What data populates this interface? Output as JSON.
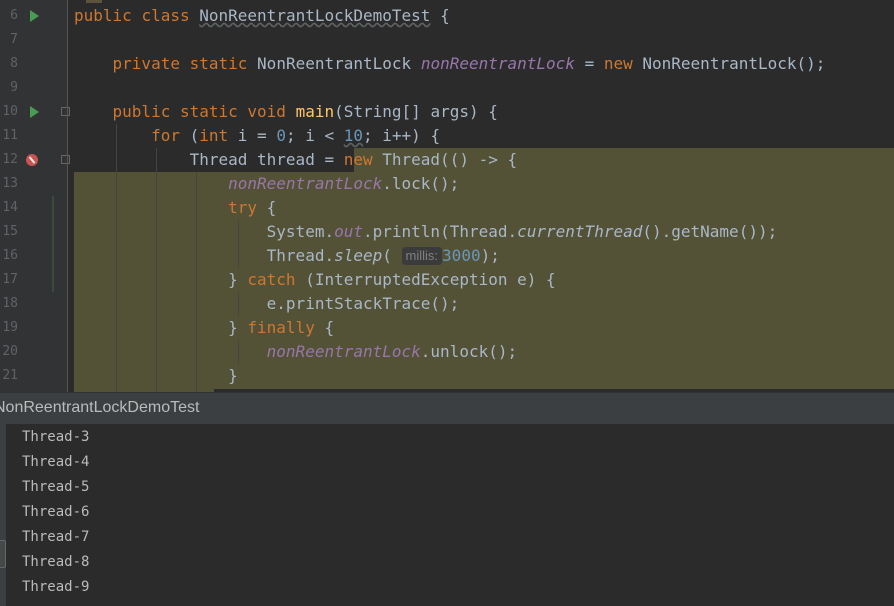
{
  "editor": {
    "line_numbers": [
      "6",
      "7",
      "8",
      "9",
      "10",
      "11",
      "12",
      "13",
      "14",
      "15",
      "16",
      "17",
      "18",
      "19",
      "20",
      "21"
    ],
    "hint_millis": "millis:",
    "tokens": {
      "kw_public": "public",
      "kw_class": "class",
      "class_name": "NonReentrantLockDemoTest",
      "brace_open": " {",
      "kw_private": "private",
      "kw_static": "static",
      "type_lock": "NonReentrantLock",
      "field_lock": "nonReentrantLock",
      "assign": " = ",
      "kw_new": "new",
      "ctor_lock": " NonReentrantLock();",
      "kw_void": "void",
      "method_main": "main",
      "main_params": "(String[] args) {",
      "kw_for": "for",
      "for_open": " (",
      "kw_int": "int",
      "for_init": " i = ",
      "num_0": "0",
      "for_cond": "; i < ",
      "num_10": "10",
      "for_end": "; i++) {",
      "thread_decl": "Thread thread = ",
      "thread_ctor": " Thread(() -> {",
      "lock_call": ".lock();",
      "kw_try": "try",
      "system": "System.",
      "out": "out",
      "println_open": ".println(Thread.",
      "current_thread": "currentThread",
      "println_close": "().getName());",
      "thread_dot": "Thread.",
      "sleep": "sleep",
      "paren_open": "(",
      "num_3000": "3000",
      "paren_close": ");",
      "catch_open": "} ",
      "kw_catch": "catch",
      "catch_params": " (InterruptedException e) {",
      "print_stack": "e.printStackTrace();",
      "kw_finally": "finally",
      "unlock_call": ".unlock();",
      "close_brace": "}"
    }
  },
  "run_panel": {
    "title": "NonReentrantLockDemoTest",
    "output": [
      "Thread-3",
      "Thread-4",
      "Thread-5",
      "Thread-6",
      "Thread-7",
      "Thread-8",
      "Thread-9"
    ]
  },
  "colors": {
    "background": "#2b2b2b",
    "keyword": "#cc7832",
    "method": "#ffc66d",
    "field": "#9876aa",
    "number": "#6897bb",
    "plain": "#a9b7c6",
    "highlight": "#535237",
    "run_icon": "#499c54",
    "breakpoint": "#c75450"
  },
  "icons": [
    "run-icon",
    "fold-icon",
    "breakpoint-icon"
  ]
}
